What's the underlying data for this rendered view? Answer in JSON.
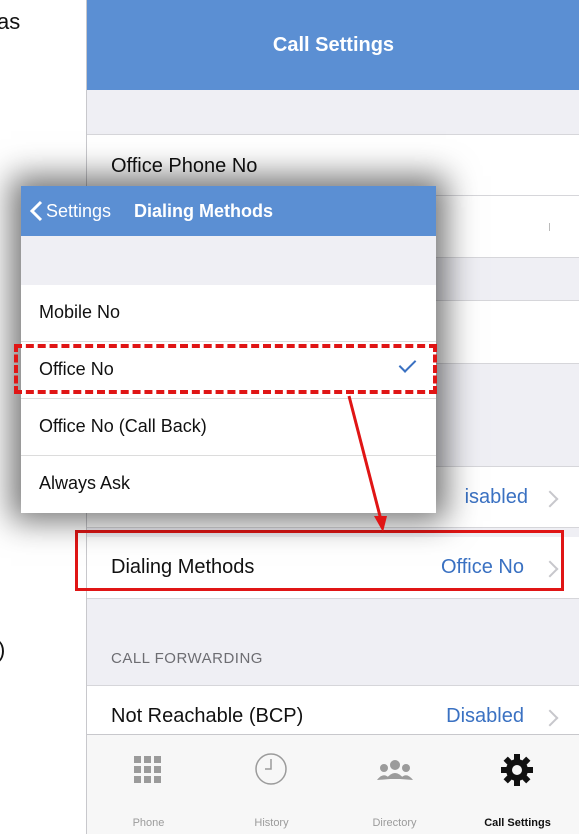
{
  "background_text": {
    "line1": "as",
    "line2": ")"
  },
  "main_screen": {
    "title": "Call Settings",
    "rows": [
      {
        "label": "Office Phone No"
      },
      {
        "label": "",
        "value_partial": "isabled"
      },
      {
        "label": "Dialing Methods",
        "value": "Office No"
      }
    ],
    "call_forwarding_header": "CALL FORWARDING",
    "not_reachable": {
      "label": "Not Reachable (BCP)",
      "value": "Disabled"
    }
  },
  "tabs": [
    {
      "label": "Phone",
      "icon": "grid-icon"
    },
    {
      "label": "History",
      "icon": "clock-icon"
    },
    {
      "label": "Directory",
      "icon": "people-icon"
    },
    {
      "label": "Call Settings",
      "icon": "gear-icon",
      "active": true
    }
  ],
  "popup": {
    "back_label": "Settings",
    "title": "Dialing Methods",
    "options": [
      {
        "label": "Mobile No",
        "selected": false
      },
      {
        "label": "Office No",
        "selected": true
      },
      {
        "label": "Office No (Call Back)",
        "selected": false
      },
      {
        "label": "Always Ask",
        "selected": false
      }
    ]
  },
  "colors": {
    "nav_blue": "#5b8fd3",
    "value_blue": "#3a71c2",
    "annotation_red": "#e01515"
  }
}
